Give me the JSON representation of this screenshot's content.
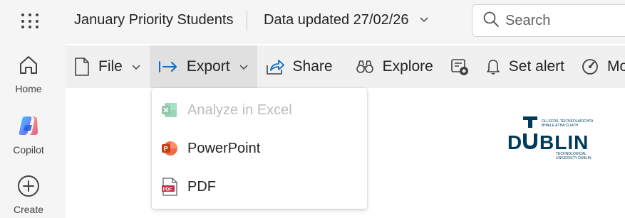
{
  "header": {
    "report_title": "January Priority Students",
    "data_updated": "Data updated 27/02/26",
    "search_placeholder": "Search"
  },
  "rail": {
    "items": [
      {
        "label": "Home",
        "icon": "home-icon"
      },
      {
        "label": "Copilot",
        "icon": "copilot-icon"
      },
      {
        "label": "Create",
        "icon": "plus-circle-icon"
      }
    ]
  },
  "toolbar": {
    "file": "File",
    "export": "Export",
    "share": "Share",
    "explore": "Explore",
    "set_alert": "Set alert",
    "more": "More"
  },
  "export_menu": {
    "items": [
      {
        "label": "Analyze in Excel",
        "icon": "excel-icon",
        "enabled": false
      },
      {
        "label": "PowerPoint",
        "icon": "powerpoint-icon",
        "enabled": true
      },
      {
        "label": "PDF",
        "icon": "pdf-icon",
        "enabled": true
      }
    ]
  },
  "logo": {
    "letters": "TU DUBLIN",
    "small_text_top": "OLLSCOIL TEICNEOLAÍOCHTA BHAILE ÁTHA CLIATH",
    "small_text_bottom": "TECHNOLOGICAL UNIVERSITY DUBLIN"
  },
  "colors": {
    "accent_blue": "#0f6cbd",
    "logo_navy": "#003b5c",
    "powerpoint_red": "#c43e1c",
    "pdf_red": "#c4314b"
  }
}
